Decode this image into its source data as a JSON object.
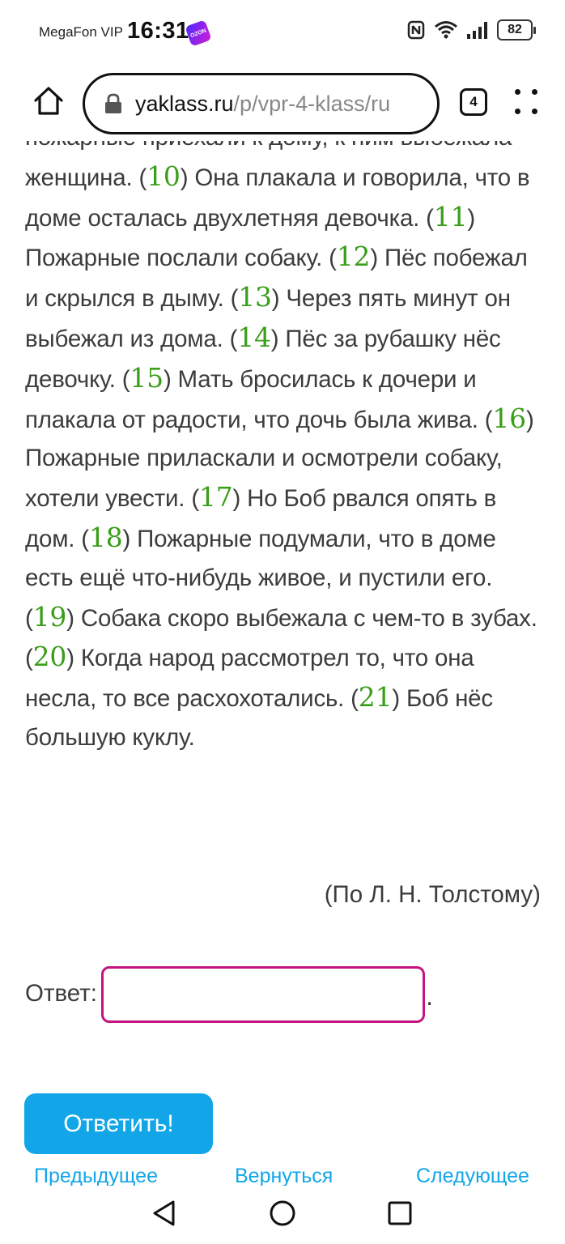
{
  "status_bar": {
    "carrier": "MegaFon VIP",
    "time": "16:31",
    "ozon_badge": "OZON",
    "battery": "82",
    "icons": [
      "nfc-icon",
      "wifi-icon",
      "signal-icon",
      "battery-icon"
    ]
  },
  "browser": {
    "url_domain": "yaklass.ru",
    "url_path": "/p/vpr-4-klass/ru",
    "tab_count": "4",
    "icons": [
      "home-icon",
      "lock-icon",
      "more-vert-icon"
    ]
  },
  "story": {
    "lines_top": "пожарные приехали к дому, к ним выбежала",
    "segments": [
      {
        "text": "женщина. "
      },
      {
        "num": "10"
      },
      {
        "text": " Она плакала и говорила, что в доме осталась двухлетняя девочка. "
      },
      {
        "num": "11"
      },
      {
        "text": " Пожарные послали собаку. "
      },
      {
        "num": "12"
      },
      {
        "text": " Пёс побежал и скрылся в дыму. "
      },
      {
        "num": "13"
      },
      {
        "text": " Через пять минут он выбежал из дома. "
      },
      {
        "num": "14"
      },
      {
        "text": " Пёс за рубашку нёс девочку. "
      },
      {
        "num": "15"
      },
      {
        "text": " Мать бросилась к дочери и плакала от радости, что дочь была жива. "
      },
      {
        "num": "16"
      },
      {
        "text": " Пожарные приласкали и осмотрели собаку, хотели увести. "
      },
      {
        "num": "17"
      },
      {
        "text": " Но Боб рвался опять в дом. "
      },
      {
        "num": "18"
      },
      {
        "text": " Пожарные подумали, что в доме есть ещё что-нибудь живое, и пустили его. "
      },
      {
        "num": "19"
      },
      {
        "text": " Собака скоро выбежала с чем-то в зубах. "
      },
      {
        "num": "20"
      },
      {
        "text": " Когда народ рассмотрел то, что она несла, то все расхохотались. "
      },
      {
        "num": "21"
      },
      {
        "text": " Боб нёс большую куклу."
      }
    ],
    "author": "(По Л. Н. Толстому)"
  },
  "answer": {
    "label": "Ответ:",
    "value": "",
    "trailing": "."
  },
  "submit_label": "Ответить!",
  "nav": {
    "prev_label": "Предыдущее",
    "up_label": "Вернуться",
    "next_label": "Следующее"
  },
  "colors": {
    "accent": "#12a6e8",
    "number": "#3a9e1a",
    "input_border": "#c41480"
  }
}
